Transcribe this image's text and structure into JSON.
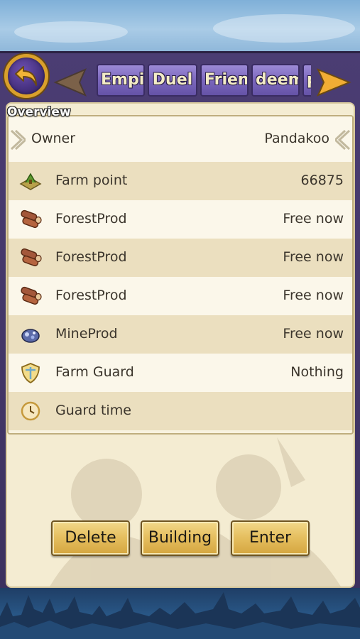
{
  "nav": {
    "tabs": [
      {
        "label": "Empire"
      },
      {
        "label": "Duel"
      },
      {
        "label": "Friend"
      },
      {
        "label": "deem"
      },
      {
        "label": "p"
      }
    ]
  },
  "overview": {
    "title": "Overview",
    "owner": {
      "label": "Owner",
      "value": "Pandakoo"
    },
    "rows": [
      {
        "icon": "farm-icon",
        "label": "Farm point",
        "value": "66875"
      },
      {
        "icon": "log-icon",
        "label": "ForestProd",
        "value": "Free now"
      },
      {
        "icon": "log-icon",
        "label": "ForestProd",
        "value": "Free now"
      },
      {
        "icon": "log-icon",
        "label": "ForestProd",
        "value": "Free now"
      },
      {
        "icon": "ore-icon",
        "label": "MineProd",
        "value": "Free now"
      },
      {
        "icon": "shield-icon",
        "label": "Farm Guard",
        "value": "Nothing"
      },
      {
        "icon": "clock-icon",
        "label": "Guard time",
        "value": ""
      }
    ]
  },
  "actions": {
    "delete": "Delete",
    "building": "Building",
    "enter": "Enter"
  },
  "colors": {
    "frame": "#4b3d73",
    "panel": "#f4ecd2",
    "button": "#e6c061",
    "tab": "#7b67bd"
  }
}
